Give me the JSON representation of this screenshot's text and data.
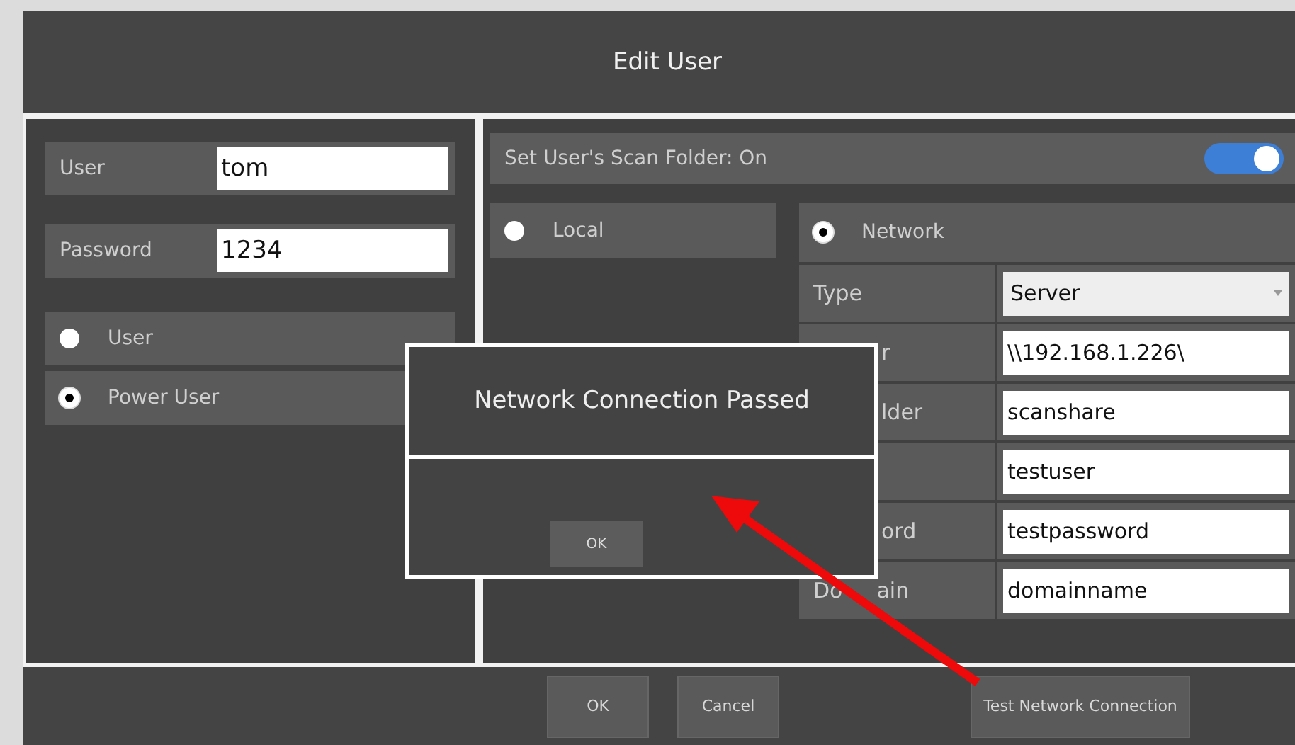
{
  "window": {
    "title": "Edit User"
  },
  "credentials": [
    {
      "label": "User",
      "value": "tom"
    },
    {
      "label": "Password",
      "value": "1234"
    }
  ],
  "roles": [
    {
      "label": "User",
      "selected": false
    },
    {
      "label": "Power User",
      "selected": true
    }
  ],
  "scan_folder": {
    "label": "Set User's Scan Folder: On",
    "on": true
  },
  "locations": [
    {
      "label": "Local",
      "selected": false
    },
    {
      "label": "Network",
      "selected": true
    }
  ],
  "network_fields": [
    {
      "kind": "select",
      "label": "Type",
      "value": "Server",
      "clipped": false
    },
    {
      "kind": "text",
      "label": "r",
      "value": "\\\\192.168.1.226\\",
      "clipped": true
    },
    {
      "kind": "text",
      "label": "lder",
      "value": "scanshare",
      "clipped": true
    },
    {
      "kind": "text",
      "value": "testuser"
    },
    {
      "kind": "text",
      "label": "ord",
      "value": "testpassword",
      "clipped": true
    },
    {
      "kind": "text",
      "label": "Do",
      "label_tail": "ain",
      "value": "domainname",
      "clipped": false
    }
  ],
  "dialog": {
    "message": "Network Connection Passed",
    "button": "OK"
  },
  "buttons": [
    {
      "kind": "plain",
      "label": "OK"
    },
    {
      "kind": "plain",
      "label": "Cancel"
    },
    {
      "kind": "wide",
      "label": "Test Network Connection"
    }
  ]
}
